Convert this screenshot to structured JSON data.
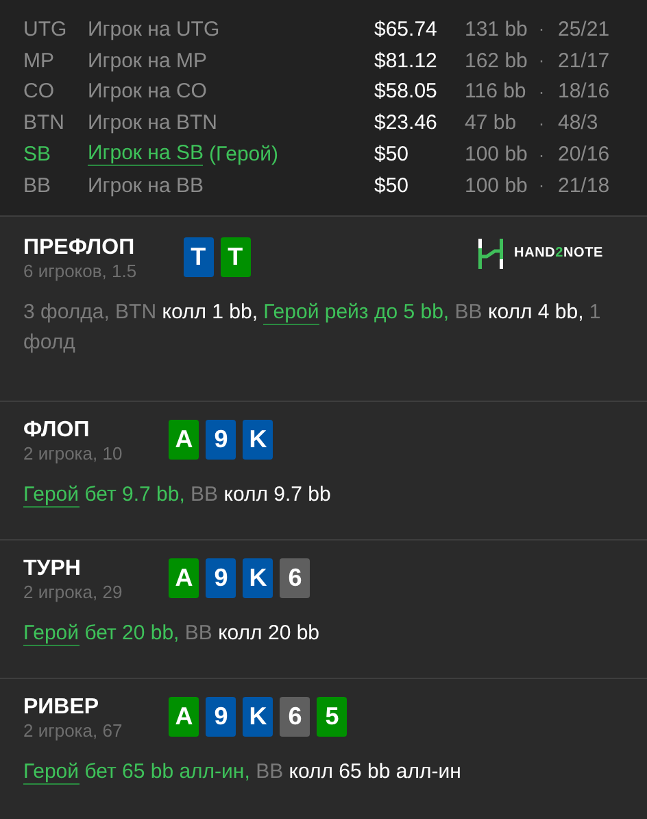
{
  "players": [
    {
      "position": "UTG",
      "name": "Игрок на UTG",
      "hero": false,
      "stack": "$65.74",
      "bb": "131 bb",
      "separator": "·",
      "stat": "25/21"
    },
    {
      "position": "MP",
      "name": "Игрок на MP",
      "hero": false,
      "stack": "$81.12",
      "bb": "162 bb",
      "separator": "·",
      "stat": "21/17"
    },
    {
      "position": "CO",
      "name": "Игрок на CO",
      "hero": false,
      "stack": "$58.05",
      "bb": "116 bb",
      "separator": "·",
      "stat": "18/16"
    },
    {
      "position": "BTN",
      "name": "Игрок на BTN",
      "hero": false,
      "stack": "$23.46",
      "bb": "47 bb",
      "separator": "·",
      "stat": "48/3"
    },
    {
      "position": "SB",
      "name": "Игрок на SB",
      "hero": true,
      "hero_suffix": "(Герой)",
      "stack": "$50",
      "bb": "100 bb",
      "separator": "·",
      "stat": "20/16"
    },
    {
      "position": "BB",
      "name": "Игрок на BB",
      "hero": false,
      "stack": "$50",
      "bb": "100 bb",
      "separator": "·",
      "stat": "21/18"
    }
  ],
  "logo": {
    "parts": [
      {
        "text": "HAND",
        "accent": false
      },
      {
        "text": "2",
        "accent": true
      },
      {
        "text": "NOTE",
        "accent": false
      }
    ]
  },
  "streets": [
    {
      "title": "ПРЕФЛОП",
      "info": "6 игроков, 1.5",
      "logo": true,
      "cards": [
        {
          "rank": "T",
          "color": "#0057a8"
        },
        {
          "rank": "T",
          "color": "#009000"
        }
      ],
      "actions": [
        {
          "kind": "muted",
          "text": "3 фолда, BTN "
        },
        {
          "kind": "call",
          "text": "колл 1 bb, "
        },
        {
          "kind": "hero",
          "text": "Герой"
        },
        {
          "kind": "herotext",
          "text": " рейз до 5 bb, "
        },
        {
          "kind": "muted",
          "text": "BB "
        },
        {
          "kind": "call",
          "text": "колл 4 bb, "
        },
        {
          "kind": "muted",
          "text": "1 фолд"
        }
      ]
    },
    {
      "title": "ФЛОП",
      "info": "2 игрока, 10",
      "logo": false,
      "cards": [
        {
          "rank": "A",
          "color": "#009000"
        },
        {
          "rank": "9",
          "color": "#0057a8"
        },
        {
          "rank": "K",
          "color": "#0057a8"
        }
      ],
      "actions": [
        {
          "kind": "hero",
          "text": "Герой"
        },
        {
          "kind": "herotext",
          "text": " бет 9.7 bb, "
        },
        {
          "kind": "muted",
          "text": "BB "
        },
        {
          "kind": "call",
          "text": "колл 9.7 bb"
        }
      ]
    },
    {
      "title": "ТУРН",
      "info": "2 игрока, 29",
      "logo": false,
      "cards": [
        {
          "rank": "A",
          "color": "#009000"
        },
        {
          "rank": "9",
          "color": "#0057a8"
        },
        {
          "rank": "K",
          "color": "#0057a8"
        },
        {
          "rank": "6",
          "color": "#5f5f5f"
        }
      ],
      "actions": [
        {
          "kind": "hero",
          "text": "Герой"
        },
        {
          "kind": "herotext",
          "text": " бет 20 bb, "
        },
        {
          "kind": "muted",
          "text": "BB "
        },
        {
          "kind": "call",
          "text": "колл 20 bb"
        }
      ]
    },
    {
      "title": "РИВЕР",
      "info": "2 игрока, 67",
      "logo": false,
      "cards": [
        {
          "rank": "A",
          "color": "#009000"
        },
        {
          "rank": "9",
          "color": "#0057a8"
        },
        {
          "rank": "K",
          "color": "#0057a8"
        },
        {
          "rank": "6",
          "color": "#5f5f5f"
        },
        {
          "rank": "5",
          "color": "#009000"
        }
      ],
      "actions": [
        {
          "kind": "hero",
          "text": "Герой"
        },
        {
          "kind": "herotext",
          "text": " бет 65 bb алл-ин, "
        },
        {
          "kind": "muted",
          "text": "BB "
        },
        {
          "kind": "call",
          "text": "колл 65 bb алл-ин"
        }
      ]
    }
  ]
}
